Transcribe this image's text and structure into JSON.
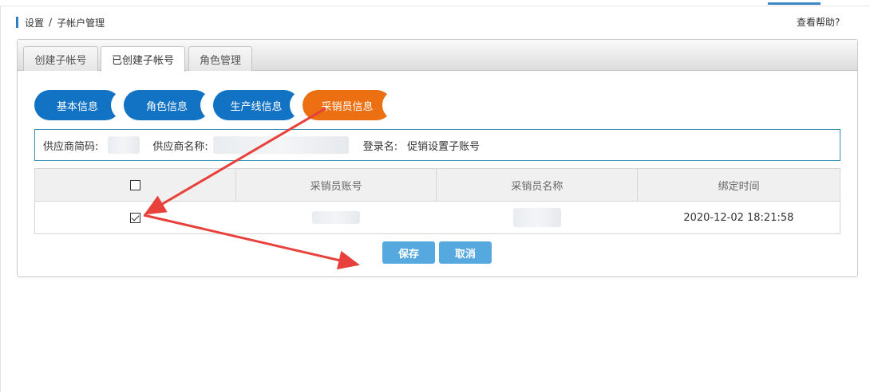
{
  "breadcrumb": {
    "parent": "设置",
    "separator": "/",
    "current": "子帐户管理"
  },
  "help_link": "查看帮助?",
  "tabs": [
    {
      "label": "创建子帐号"
    },
    {
      "label": "已创建子帐号"
    },
    {
      "label": "角色管理"
    }
  ],
  "active_tab": "已创建子帐号",
  "steps": [
    {
      "label": "基本信息"
    },
    {
      "label": "角色信息"
    },
    {
      "label": "生产线信息"
    },
    {
      "label": "采销员信息"
    }
  ],
  "active_step": "采销员信息",
  "info": {
    "supplier_code_label": "供应商简码:",
    "supplier_name_label": "供应商名称:",
    "login_label": "登录名:",
    "login_value": "促销设置子账号"
  },
  "table": {
    "headers": [
      "采销员账号",
      "采销员名称",
      "绑定时间"
    ],
    "rows": [
      {
        "checked": true,
        "bind_time": "2020-12-02 18:21:58"
      }
    ]
  },
  "buttons": {
    "save": "保存",
    "cancel": "取消"
  },
  "colors": {
    "step_blue": "#1273c4",
    "step_active": "#ec7011",
    "button_blue": "#56a9df",
    "annotation_red": "#e8403a"
  }
}
